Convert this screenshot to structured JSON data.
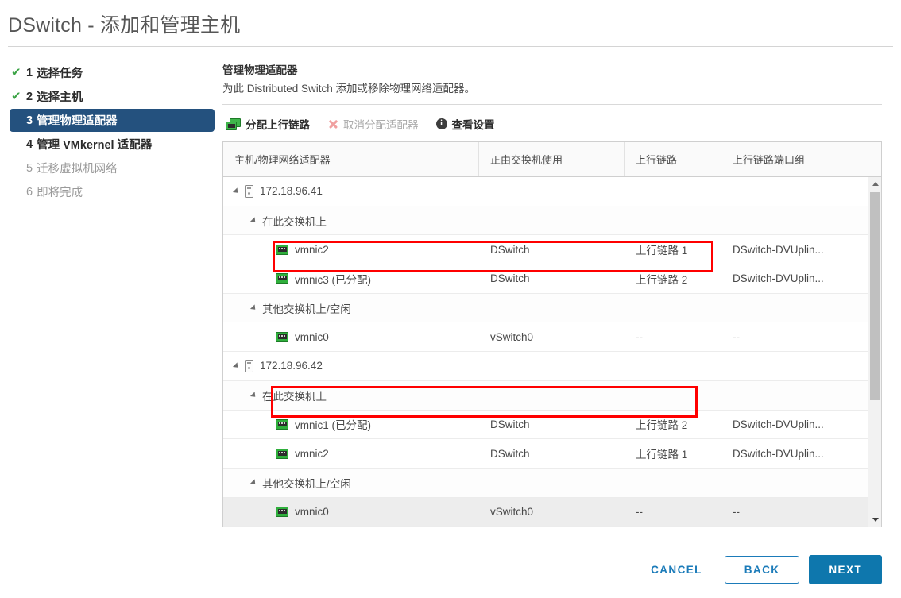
{
  "window": {
    "title": "DSwitch - 添加和管理主机"
  },
  "steps": [
    {
      "num": "1",
      "label": "选择任务",
      "state": "done",
      "check": "✔"
    },
    {
      "num": "2",
      "label": "选择主机",
      "state": "done",
      "check": "✔"
    },
    {
      "num": "3",
      "label": "管理物理适配器",
      "state": "active",
      "check": ""
    },
    {
      "num": "4",
      "label": "管理 VMkernel 适配器",
      "state": "upcoming",
      "check": ""
    },
    {
      "num": "5",
      "label": "迁移虚拟机网络",
      "state": "pending",
      "check": ""
    },
    {
      "num": "6",
      "label": "即将完成",
      "state": "pending",
      "check": ""
    }
  ],
  "panel": {
    "heading": "管理物理适配器",
    "subtitle": "为此 Distributed Switch 添加或移除物理网络适配器。"
  },
  "toolbar": {
    "assign_uplink": "分配上行链路",
    "unassign_adapter": "取消分配适配器",
    "view_settings": "查看设置",
    "info_glyph": "i"
  },
  "table": {
    "columns": [
      "主机/物理网络适配器",
      "正由交换机使用",
      "上行链路",
      "上行链路端口组"
    ],
    "rows": [
      {
        "type": "host",
        "label": "172.18.96.41",
        "used_by": "",
        "uplink": "",
        "portgroup": ""
      },
      {
        "type": "group",
        "label": "在此交换机上",
        "used_by": "",
        "uplink": "",
        "portgroup": ""
      },
      {
        "type": "nic",
        "label": "vmnic2",
        "used_by": "DSwitch",
        "uplink": "上行链路 1",
        "portgroup": "DSwitch-DVUplin..."
      },
      {
        "type": "nic",
        "label": "vmnic3 (已分配)",
        "used_by": "DSwitch",
        "uplink": "上行链路 2",
        "portgroup": "DSwitch-DVUplin...",
        "highlight": true
      },
      {
        "type": "group",
        "label": "其他交换机上/空闲",
        "used_by": "",
        "uplink": "",
        "portgroup": ""
      },
      {
        "type": "nic",
        "label": "vmnic0",
        "used_by": "vSwitch0",
        "uplink": "--",
        "portgroup": "--"
      },
      {
        "type": "host",
        "label": "172.18.96.42",
        "used_by": "",
        "uplink": "",
        "portgroup": ""
      },
      {
        "type": "group",
        "label": "在此交换机上",
        "used_by": "",
        "uplink": "",
        "portgroup": ""
      },
      {
        "type": "nic",
        "label": "vmnic1 (已分配)",
        "used_by": "DSwitch",
        "uplink": "上行链路 2",
        "portgroup": "DSwitch-DVUplin...",
        "highlight": true
      },
      {
        "type": "nic",
        "label": "vmnic2",
        "used_by": "DSwitch",
        "uplink": "上行链路 1",
        "portgroup": "DSwitch-DVUplin..."
      },
      {
        "type": "group",
        "label": "其他交换机上/空闲",
        "used_by": "",
        "uplink": "",
        "portgroup": ""
      },
      {
        "type": "nic",
        "label": "vmnic0",
        "used_by": "vSwitch0",
        "uplink": "--",
        "portgroup": "--",
        "selected": true
      }
    ]
  },
  "footer": {
    "cancel": "CANCEL",
    "back": "BACK",
    "next": "NEXT"
  },
  "colors": {
    "accent_blue": "#1b7bb9",
    "next_blue": "#0e77ad",
    "step_active_bg": "#24517e",
    "check_green": "#3aa345",
    "highlight_red": "#ff0000",
    "nic_green": "#2faf3c"
  }
}
